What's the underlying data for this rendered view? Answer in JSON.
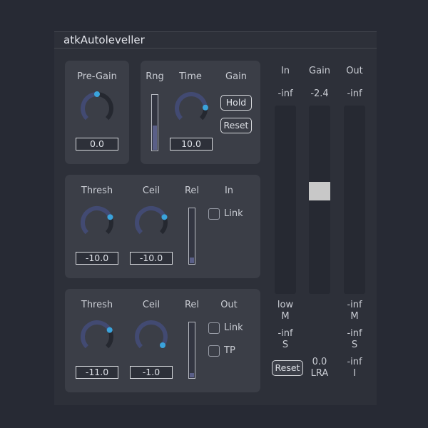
{
  "app": {
    "title": "atkAutoleveller"
  },
  "input_panel": {
    "pregain": {
      "label": "Pre-Gain",
      "value": "0.0",
      "position": 0.5
    },
    "range": {
      "label": "Rng",
      "position": 0.45
    },
    "time": {
      "label": "Time",
      "value": "10.0",
      "position": 0.82
    },
    "gain": {
      "label": "Gain",
      "hold_label": "Hold",
      "reset_label": "Reset"
    }
  },
  "in_gate": {
    "thresh": {
      "label": "Thresh",
      "value": "-10.0",
      "position": 0.75
    },
    "ceil": {
      "label": "Ceil",
      "value": "-10.0",
      "position": 0.75
    },
    "rel": {
      "label": "Rel",
      "position": 0.1
    },
    "section_label": "In",
    "link_label": "Link",
    "link_checked": false
  },
  "out_gate": {
    "thresh": {
      "label": "Thresh",
      "value": "-11.0",
      "position": 0.73
    },
    "ceil": {
      "label": "Ceil",
      "value": "-1.0",
      "position": 0.97
    },
    "rel": {
      "label": "Rel",
      "position": 0.0
    },
    "section_label": "Out",
    "link_label": "Link",
    "link_checked": false,
    "tp_label": "TP",
    "tp_checked": false
  },
  "meters": {
    "in": {
      "label": "In",
      "peak": "-inf"
    },
    "gain": {
      "label": "Gain",
      "peak": "-2.4",
      "level": 0.55
    },
    "out": {
      "label": "Out",
      "peak": "-inf"
    }
  },
  "stats": {
    "in_m_value": "low",
    "in_m_label": "M",
    "in_s_value": "-inf",
    "in_s_label": "S",
    "reset_label": "Reset",
    "lra_value": "0.0",
    "lra_label": "LRA",
    "out_m_value": "-inf",
    "out_m_label": "M",
    "out_s_value": "-inf",
    "out_s_label": "S",
    "out_i_value": "-inf",
    "out_i_label": "I"
  },
  "colors": {
    "background": "#272a34",
    "panel": "#3b3e47",
    "knob_track": "#424a72",
    "knob_remainder": "#252830",
    "knob_handle": "#3aa3dc",
    "slider_fill": "#5a5f88",
    "gain_handle": "#c8c8c8"
  }
}
